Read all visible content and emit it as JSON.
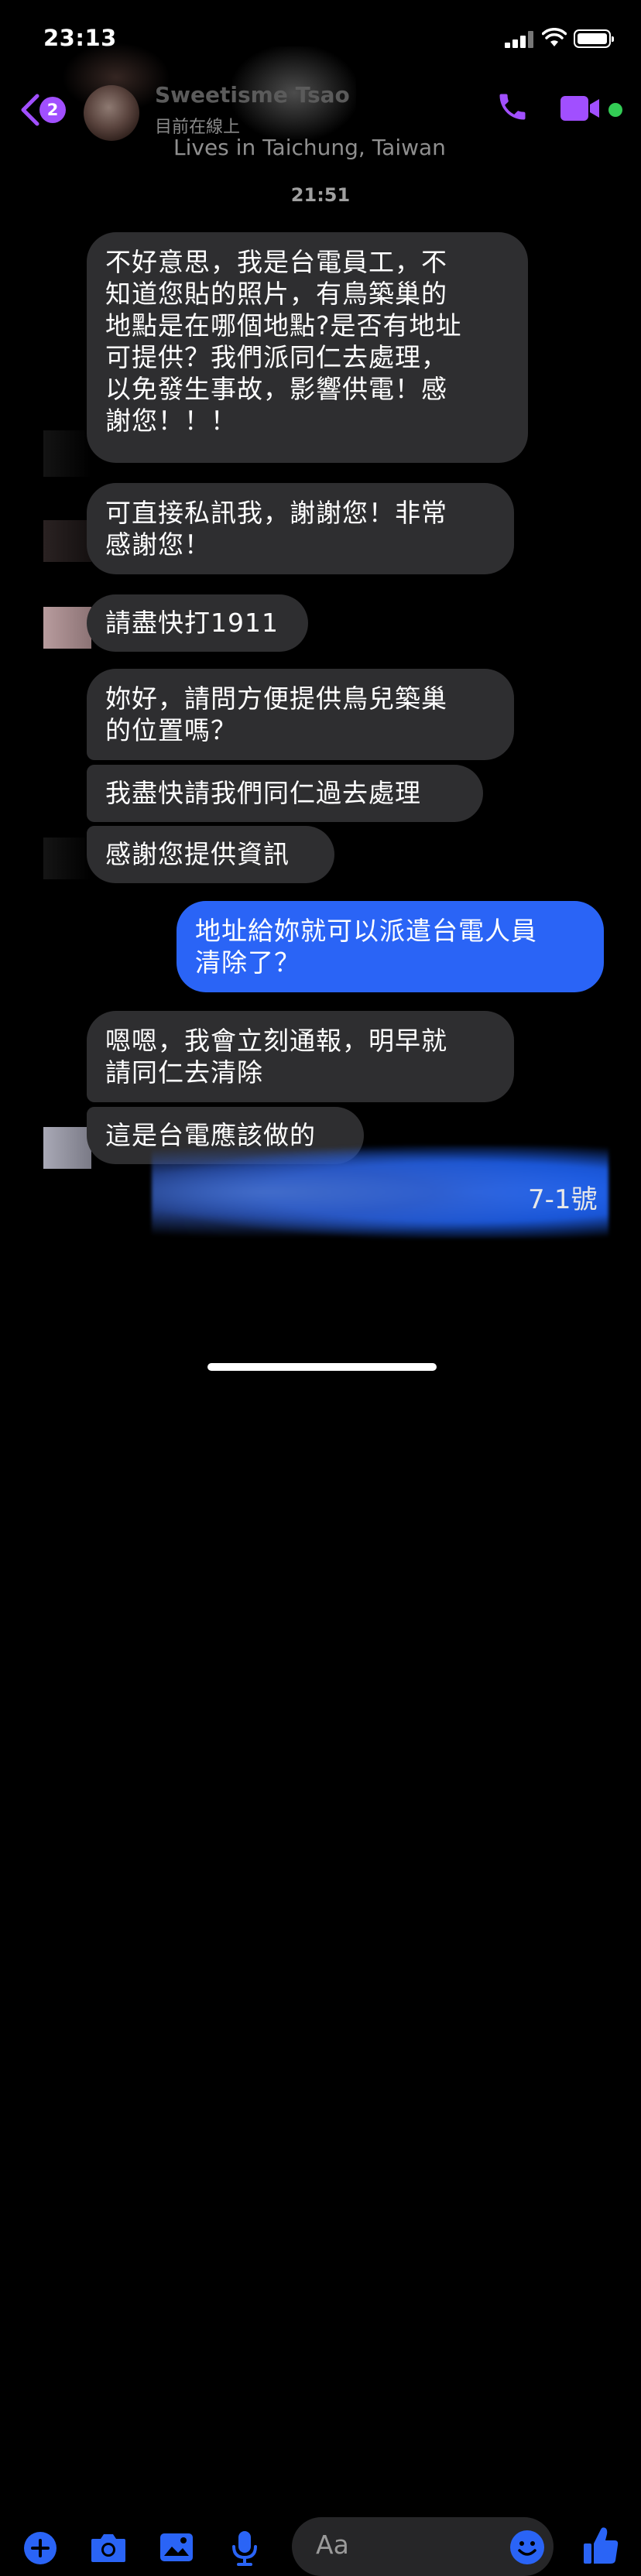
{
  "status_bar": {
    "time": "23:13"
  },
  "header": {
    "back_badge": "2",
    "contact_name": "Sweetisme Tsao",
    "contact_status": "目前在線上",
    "contact_location": "Lives in Taichung, Taiwan"
  },
  "thread": {
    "timestamp": "21:51",
    "messages": [
      {
        "from": "them",
        "text": "不好意思，我是台電員工，不\n知道您貼的照片，有鳥築巢的\n地點是在哪個地點?是否有地址\n可提供？我們派同仁去處理，\n以免發生事故，影響供電！感\n謝您！！！"
      },
      {
        "from": "them",
        "text": "可直接私訊我，謝謝您！非常\n感謝您！"
      },
      {
        "from": "them",
        "text": "請盡快打1911"
      },
      {
        "from": "them",
        "text": "妳好，請問方便提供鳥兒築巢\n的位置嗎？"
      },
      {
        "from": "them",
        "text": "我盡快請我們同仁過去處理"
      },
      {
        "from": "them",
        "text": "感謝您提供資訊"
      },
      {
        "from": "me",
        "text": "地址給妳就可以派遣台電人員\n清除了？"
      },
      {
        "from": "them",
        "text": "嗯嗯，我會立刻通報，明早就\n請同仁去清除"
      },
      {
        "from": "them",
        "text": "這是台電應該做的"
      },
      {
        "from": "me",
        "text": "7-1號"
      }
    ]
  },
  "composer": {
    "placeholder": "Aa"
  },
  "colors": {
    "accent_purple": "#a14fff",
    "messenger_blue": "#2a64f6",
    "online_green": "#33cc55",
    "incoming_bubble": "#2e2e30"
  },
  "icons": [
    "back-chevron-icon",
    "phone-icon",
    "video-camera-icon",
    "plus-icon",
    "camera-icon",
    "image-icon",
    "microphone-icon",
    "emoji-icon",
    "thumbs-up-icon"
  ]
}
